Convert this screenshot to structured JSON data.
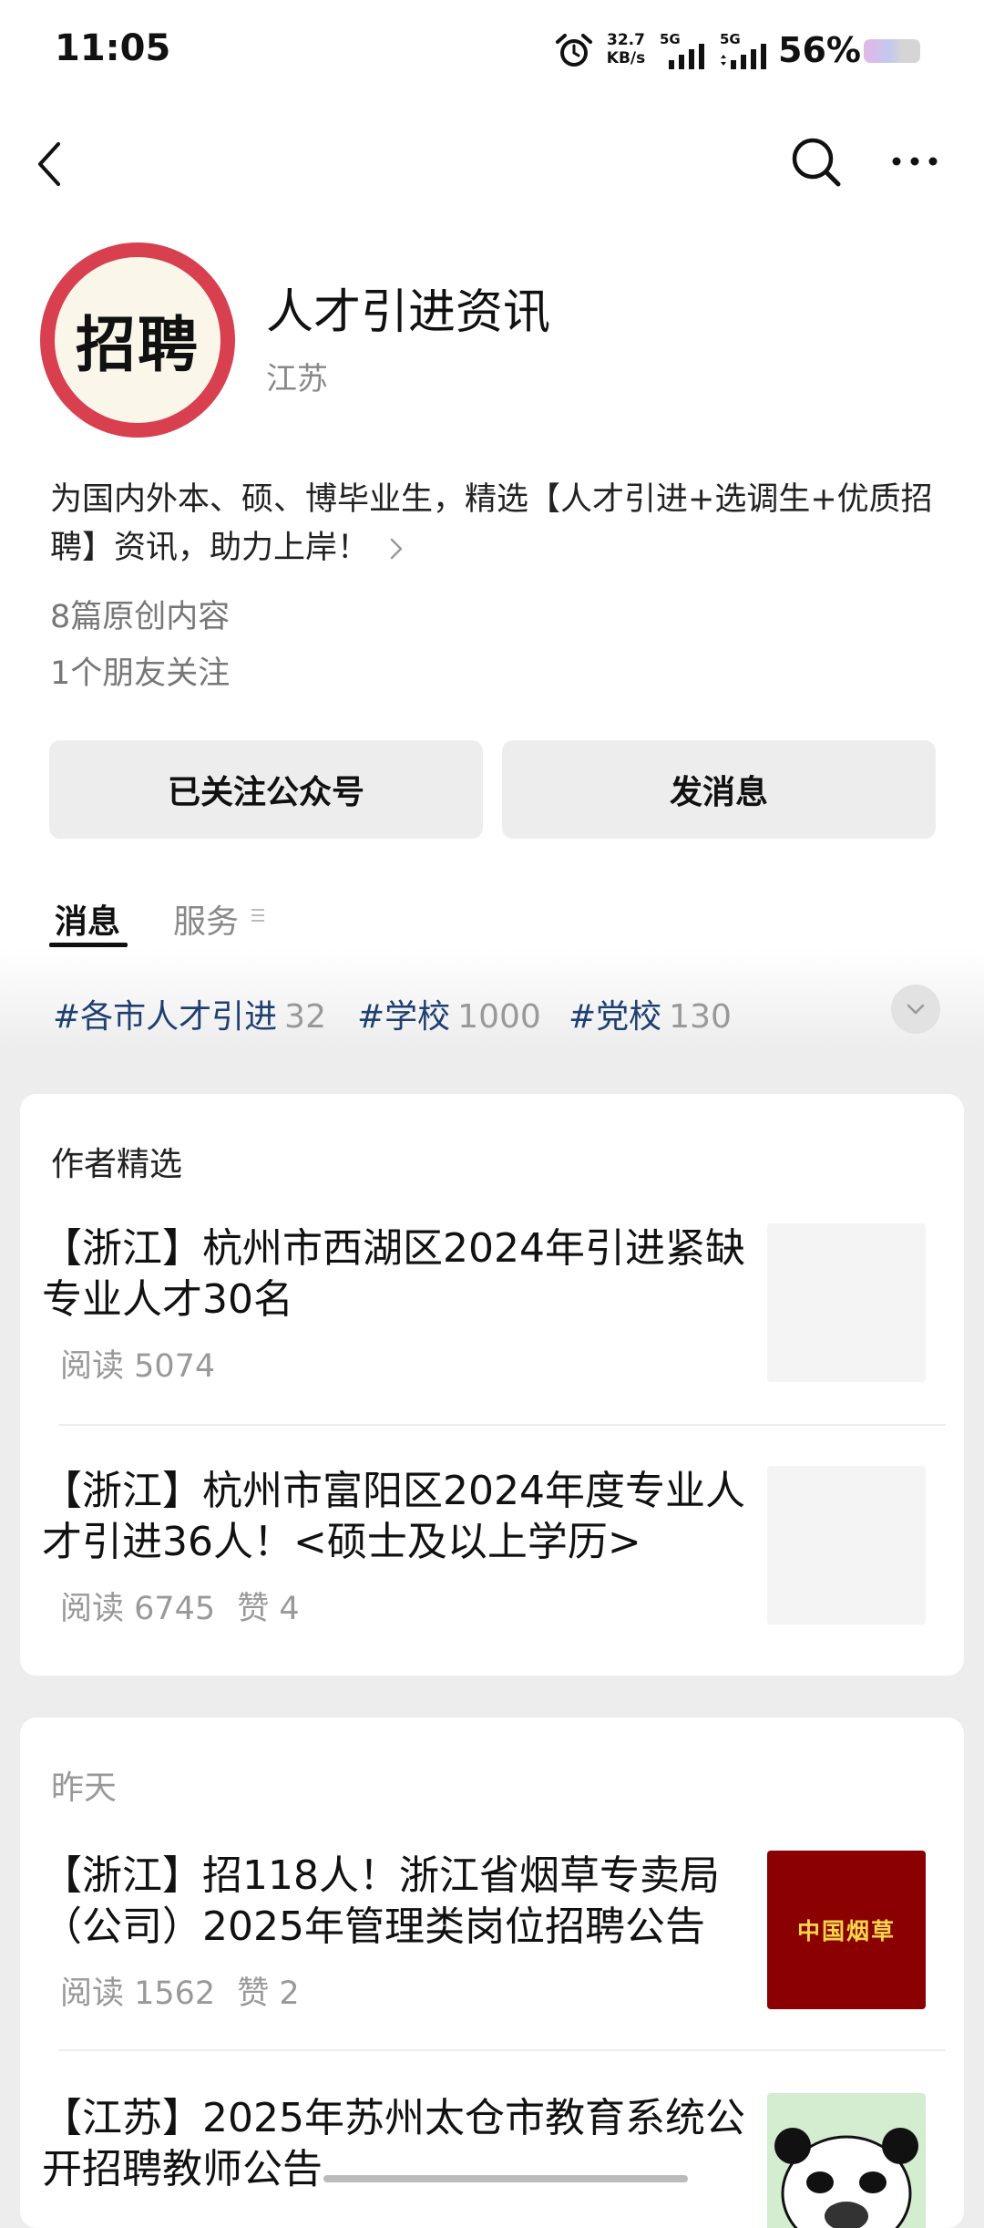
{
  "status_bar": {
    "time": "11:05",
    "net_speed_value": "32.7",
    "net_speed_unit": "KB/s",
    "signal1_label": "5G",
    "signal2_label": "5G",
    "battery": "56%",
    "icons": [
      "alarm-icon",
      "signal-icon",
      "battery-icon"
    ]
  },
  "nav": {
    "icons": [
      "back-arrow-icon",
      "search-icon",
      "more-icon"
    ]
  },
  "account": {
    "avatar_text": "招聘",
    "name": "人才引进资讯",
    "region": "江苏",
    "description": "为国内外本、硕、博毕业生，精选【人才引进+选调生+优质招聘】资讯，助力上岸！",
    "original_count": "8篇原创内容",
    "friends_following": "1个朋友关注"
  },
  "buttons": {
    "follow": "已关注公众号",
    "message": "发消息"
  },
  "tabs": {
    "messages": "消息",
    "services": "服务"
  },
  "tags": [
    {
      "name": "#各市人才引进",
      "count": "32"
    },
    {
      "name": "#学校",
      "count": "1000"
    },
    {
      "name": "#党校",
      "count": "130"
    }
  ],
  "featured": {
    "heading": "作者精选",
    "articles": [
      {
        "title": "【浙江】杭州市西湖区2024年引进紧缺专业人才30名",
        "reads": "阅读 5074",
        "likes": ""
      },
      {
        "title": "【浙江】杭州市富阳区2024年度专业人才引进36人！<硕士及以上学历>",
        "reads": "阅读 6745",
        "likes": "赞 4"
      }
    ]
  },
  "yesterday": {
    "heading": "昨天",
    "articles": [
      {
        "title": "【浙江】招118人！浙江省烟草专卖局（公司）2025年管理类岗位招聘公告",
        "reads": "阅读 1562",
        "likes": "赞 2",
        "thumb_text": "中国烟草"
      },
      {
        "title": "【江苏】2025年苏州太仓市教育系统公开招聘教师公告",
        "reads": "",
        "likes": ""
      }
    ]
  }
}
